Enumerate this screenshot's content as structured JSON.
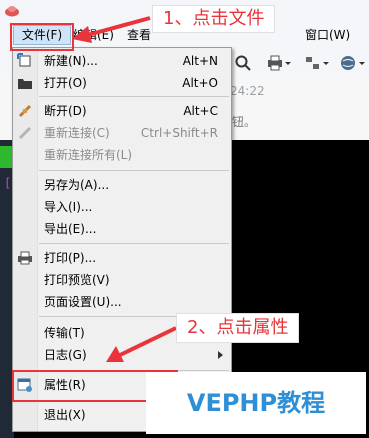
{
  "menubar": {
    "file": "文件(F)",
    "edit": "编辑(E)",
    "view": "查看",
    "window": "窗口(W)"
  },
  "background": {
    "timestamp": "24:22",
    "hint": "钮。"
  },
  "file_menu": {
    "items": [
      {
        "label": "新建(N)...",
        "shortcut": "Alt+N",
        "icon": "new-session-icon",
        "enabled": true
      },
      {
        "label": "打开(O)",
        "shortcut": "Alt+O",
        "icon": "folder-open-icon",
        "enabled": true
      },
      {
        "label": "断开(D)",
        "shortcut": "Alt+C",
        "icon": "disconnect-icon",
        "enabled": true
      },
      {
        "label": "重新连接(C)",
        "shortcut": "Ctrl+Shift+R",
        "icon": "reconnect-icon",
        "enabled": false
      },
      {
        "label": "重新连接所有(L)",
        "shortcut": "",
        "enabled": false
      },
      {
        "label": "另存为(A)...",
        "shortcut": "",
        "enabled": true
      },
      {
        "label": "导入(I)...",
        "shortcut": "",
        "enabled": true
      },
      {
        "label": "导出(E)...",
        "shortcut": "",
        "enabled": true
      },
      {
        "label": "打印(P)...",
        "shortcut": "",
        "icon": "printer-icon",
        "enabled": true
      },
      {
        "label": "打印预览(V)",
        "shortcut": "",
        "enabled": true
      },
      {
        "label": "页面设置(U)...",
        "shortcut": "",
        "enabled": true
      },
      {
        "label": "传输(T)",
        "shortcut": "",
        "enabled": true,
        "submenu": true
      },
      {
        "label": "日志(G)",
        "shortcut": "",
        "enabled": true,
        "submenu": true
      },
      {
        "label": "属性(R)",
        "shortcut": "",
        "icon": "properties-icon",
        "enabled": true
      },
      {
        "label": "退出(X)",
        "shortcut": "",
        "enabled": true
      }
    ]
  },
  "annotations": {
    "step1": "1、点击文件",
    "step2": "2、点击属性",
    "accent_color": "#e8343a"
  },
  "watermark": "VEPHP教程"
}
